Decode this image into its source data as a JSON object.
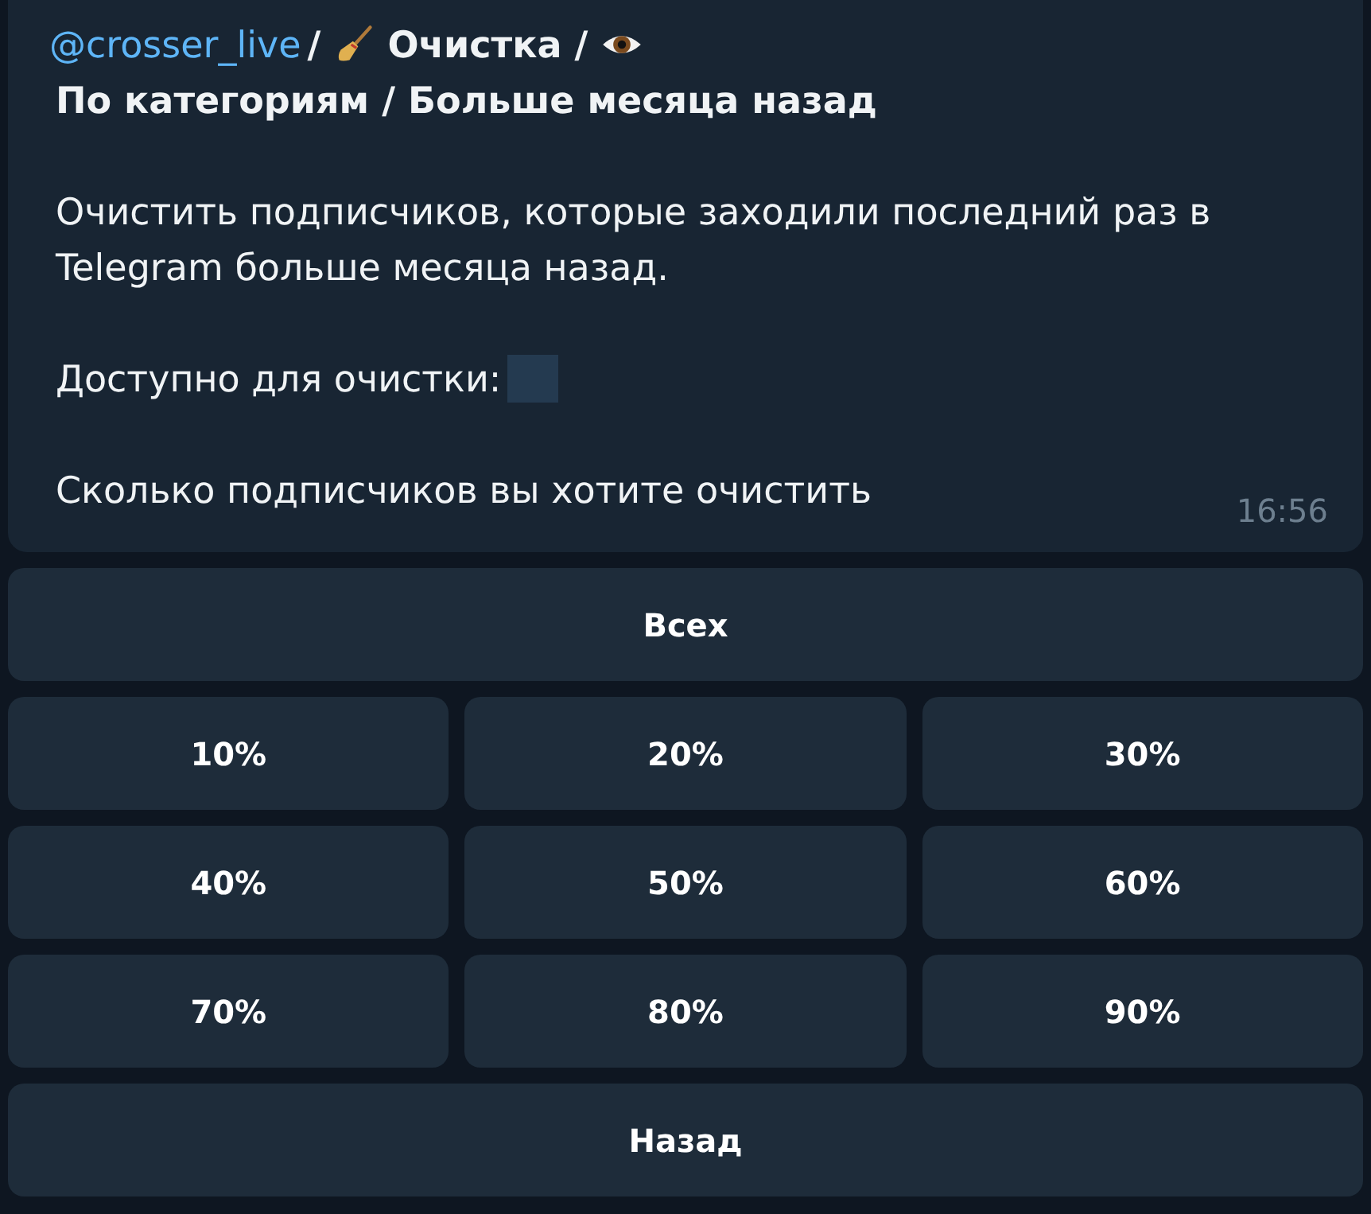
{
  "message": {
    "header": {
      "link": "@crosser_live",
      "segments": [
        {
          "kind": "text",
          "text": "/"
        },
        {
          "kind": "broom"
        },
        {
          "kind": "text",
          "text": "Очистка /"
        },
        {
          "kind": "eye"
        },
        {
          "kind": "text",
          "text": "По категориям / Больше"
        },
        {
          "kind": "text",
          "text": "месяца назад"
        }
      ]
    },
    "paragraphs": [
      {
        "kind": "text",
        "text": "Очистить подписчиков, которые заходили последний раз в Telegram больше месяца назад."
      },
      {
        "kind": "spoiler",
        "text": "Доступно для очистки:"
      },
      {
        "kind": "text",
        "text": "Сколько подписчиков вы хотите очистить"
      }
    ],
    "time": "16:56"
  },
  "keyboard": [
    [
      "Всех"
    ],
    [
      "10%",
      "20%",
      "30%"
    ],
    [
      "40%",
      "50%",
      "60%"
    ],
    [
      "70%",
      "80%",
      "90%"
    ],
    [
      "Назад"
    ]
  ]
}
